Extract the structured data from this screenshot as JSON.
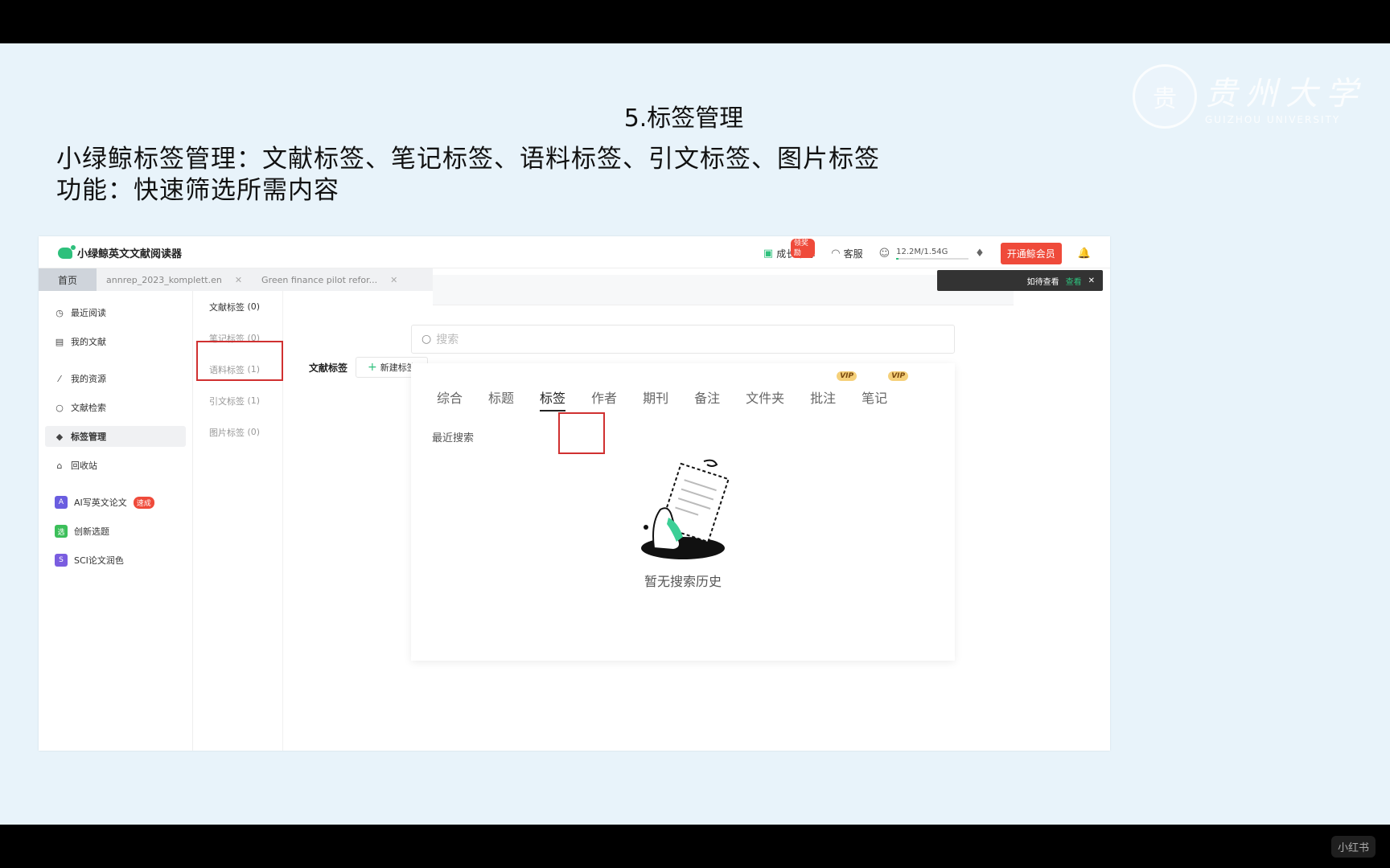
{
  "slide": {
    "title": "5.标签管理",
    "line1": "小绿鲸标签管理：文献标签、笔记标签、语料标签、引文标签、图片标签",
    "line2": "功能：快速筛选所需内容",
    "university_cn": "贵州大学",
    "university_en": "GUIZHOU UNIVERSITY",
    "seal": "贵"
  },
  "app": {
    "name": "小绿鲸英文文献阅读器",
    "growth_label": "成长中心",
    "growth_badge": "领奖励",
    "service_label": "客服",
    "storage": "12.2M/1.54G",
    "storage_fraction": 0.01,
    "vip_button": "开通鲸会员",
    "toast_text": "如待查看",
    "toast_view": "查看",
    "accent": "#2ec07c",
    "red": "#ef4a3a"
  },
  "tabs": [
    {
      "label": "首页"
    },
    {
      "label": "annrep_2023_komplett.en"
    },
    {
      "label": "Green finance pilot refor..."
    }
  ],
  "sidebar": {
    "items": [
      {
        "label": "最近阅读",
        "icon": "clock-icon"
      },
      {
        "label": "我的文献",
        "icon": "document-icon"
      },
      {
        "label": "我的资源",
        "icon": "leaf-icon"
      },
      {
        "label": "文献检索",
        "icon": "search-icon"
      },
      {
        "label": "标签管理",
        "icon": "tag-icon"
      },
      {
        "label": "回收站",
        "icon": "trash-icon"
      }
    ],
    "apps": [
      {
        "label": "AI写英文论文",
        "badge": "速成",
        "color": "#6a5de0"
      },
      {
        "label": "创新选题",
        "color": "#3cbf5a"
      },
      {
        "label": "SCI论文润色",
        "color": "#7a5de0"
      }
    ]
  },
  "tag_types": [
    {
      "label": "文献标签",
      "count": "(0)"
    },
    {
      "label": "笔记标签",
      "count": "(0)"
    },
    {
      "label": "语料标签",
      "count": "(1)"
    },
    {
      "label": "引文标签",
      "count": "(1)"
    },
    {
      "label": "图片标签",
      "count": "(0)"
    }
  ],
  "main": {
    "title": "文献标签",
    "new_tag": "新建标签"
  },
  "search": {
    "placeholder": "搜索",
    "filters": [
      {
        "label": "综合"
      },
      {
        "label": "标题"
      },
      {
        "label": "标签",
        "active": true
      },
      {
        "label": "作者"
      },
      {
        "label": "期刊"
      },
      {
        "label": "备注"
      },
      {
        "label": "文件夹"
      },
      {
        "label": "批注",
        "vip": "VIP"
      },
      {
        "label": "笔记",
        "vip": "VIP"
      }
    ],
    "recent_label": "最近搜索",
    "empty_text": "暂无搜索历史"
  },
  "watermark": "小红书"
}
